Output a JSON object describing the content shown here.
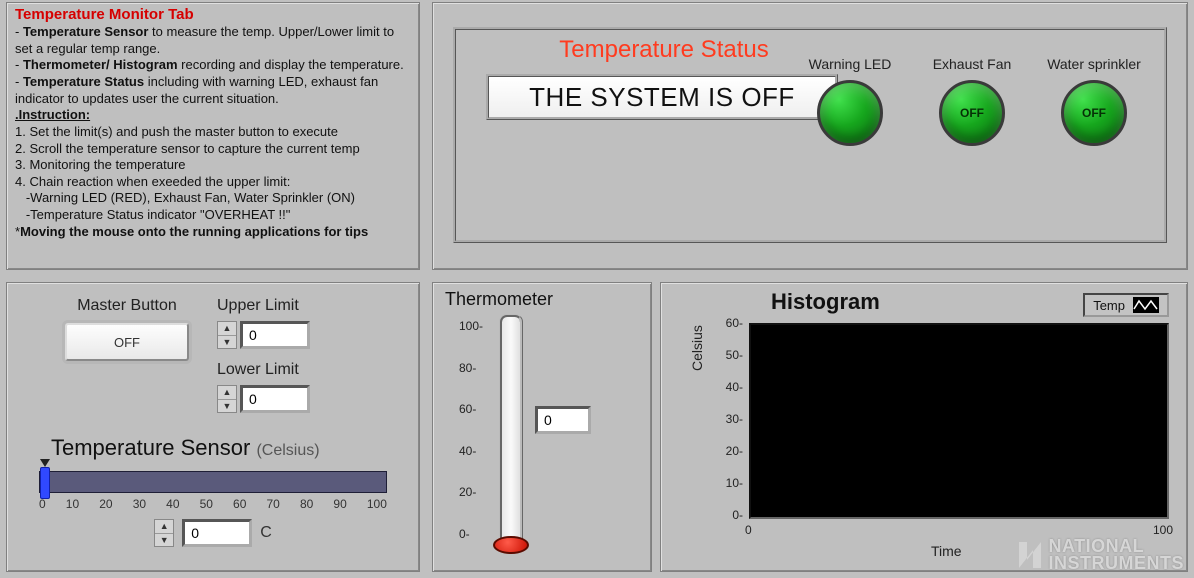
{
  "help": {
    "title": "Temperature Monitor Tab",
    "p1a": "- ",
    "p1b": "Temperature Sensor",
    "p1c": " to measure the temp. Upper/Lower limit to set a regular temp range.",
    "p2a": "- ",
    "p2b": "Thermometer/ Histogram",
    "p2c": " recording and display the temperature. - ",
    "p2d": "Temperature Status",
    "p2e": " including with warning LED, exhaust fan indicator to updates user the current situation.",
    "instrHeading": ".Instruction: ",
    "i1": "1. Set the limit(s) and push the master button to execute",
    "i2": "2. Scroll the temperature sensor to capture the current temp",
    "i3": "3. Monitoring the temperature",
    "i4": "4. Chain reaction when exeeded the upper limit:",
    "i4a": "   -Warning LED (RED), Exhaust Fan, Water Sprinkler (ON)",
    "i4b": "   -Temperature Status indicator \"OVERHEAT !!\"",
    "tipPrefix": "*",
    "tip": "Moving the mouse onto the running applications for tips"
  },
  "status": {
    "title": "Temperature Status",
    "value": "THE SYSTEM IS OFF",
    "leds": [
      {
        "label": "Warning LED",
        "text": ""
      },
      {
        "label": "Exhaust Fan",
        "text": "OFF"
      },
      {
        "label": "Water sprinkler",
        "text": "OFF"
      }
    ]
  },
  "controls": {
    "masterLabel": "Master Button",
    "masterState": "OFF",
    "upperLimitLabel": "Upper Limit",
    "upperLimitValue": "0",
    "lowerLimitLabel": "Lower Limit",
    "lowerLimitValue": "0",
    "sensorTitle": "Temperature Sensor",
    "sensorUnit": "(Celsius)",
    "sliderTicks": [
      "0",
      "10",
      "20",
      "30",
      "40",
      "50",
      "60",
      "70",
      "80",
      "90",
      "100"
    ],
    "sensorValue": "0",
    "sensorUnitShort": "C"
  },
  "thermo": {
    "title": "Thermometer",
    "ticks": [
      "100-",
      "80-",
      "60-",
      "40-",
      "20-",
      "0-"
    ],
    "value": "0"
  },
  "hist": {
    "title": "Histogram",
    "legend": "Temp",
    "yTicks": [
      "60-",
      "50-",
      "40-",
      "30-",
      "20-",
      "10-",
      "0-"
    ],
    "yLabel": "Celsius",
    "xTicks": [
      "0",
      "100"
    ],
    "xLabel": "Time"
  },
  "watermark": {
    "line1": "NATIONAL",
    "line2": "INSTRUMENTS"
  },
  "chart_data": {
    "type": "line",
    "title": "Histogram",
    "xlabel": "Time",
    "ylabel": "Celsius",
    "xlim": [
      0,
      100
    ],
    "ylim": [
      0,
      60
    ],
    "series": [
      {
        "name": "Temp",
        "x": [],
        "y": []
      }
    ]
  }
}
